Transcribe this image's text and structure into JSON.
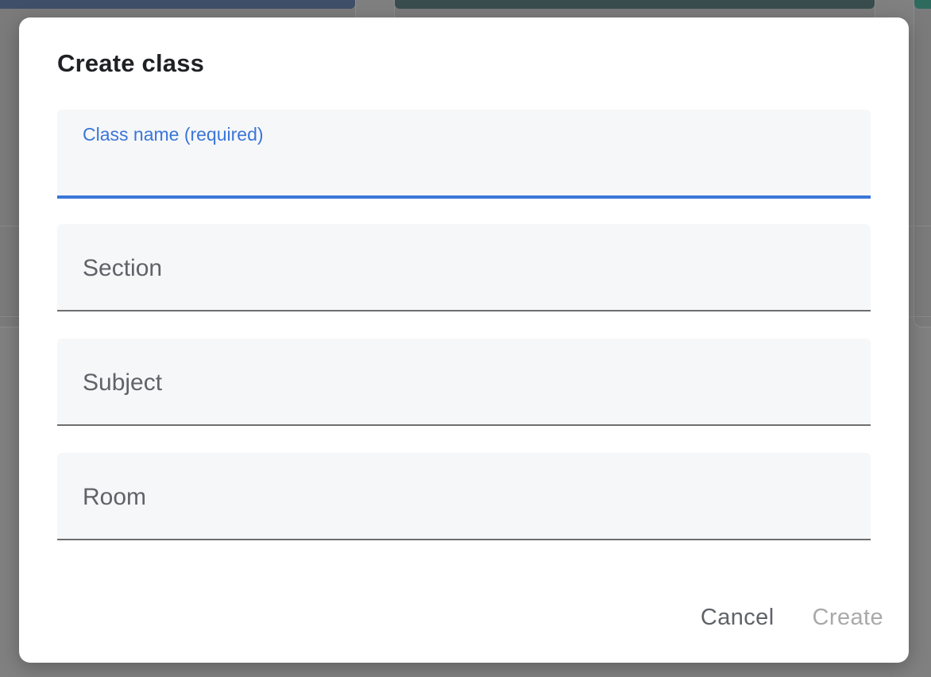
{
  "dialog": {
    "title": "Create class",
    "fields": {
      "class_name": {
        "label": "Class name (required)",
        "value": ""
      },
      "section": {
        "label": "Section",
        "value": ""
      },
      "subject": {
        "label": "Subject",
        "value": ""
      },
      "room": {
        "label": "Room",
        "value": ""
      }
    },
    "actions": {
      "cancel_label": "Cancel",
      "create_label": "Create"
    }
  },
  "colors": {
    "accent": "#3a76d8",
    "disabled_text": "#a9a9a9",
    "field_background": "#f6f7f9"
  }
}
